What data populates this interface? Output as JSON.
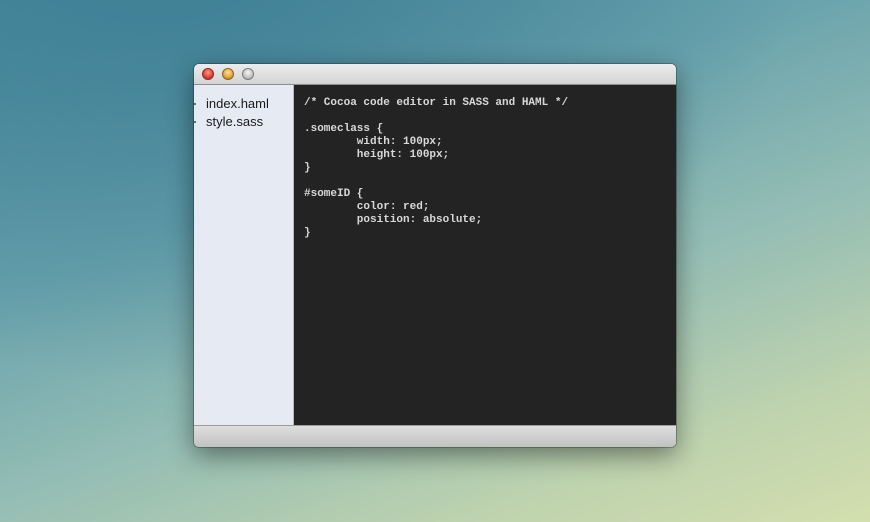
{
  "window": {
    "title": "",
    "traffic_lights": [
      {
        "name": "close-button",
        "color": "#e0443a"
      },
      {
        "name": "minimize-button",
        "color": "#e3a73b"
      },
      {
        "name": "zoom-button",
        "color": "#c6c6c6"
      }
    ]
  },
  "sidebar": {
    "files": [
      {
        "label": "index.haml"
      },
      {
        "label": "style.sass"
      }
    ]
  },
  "editor": {
    "lines": [
      "/* Cocoa code editor in SASS and HAML */",
      "",
      ".someclass {",
      "        width: 100px;",
      "        height: 100px;",
      "}",
      "",
      "#someID {",
      "        color: red;",
      "        position: absolute;",
      "}"
    ],
    "background": "#232323",
    "text_color": "#d8d8d8"
  }
}
